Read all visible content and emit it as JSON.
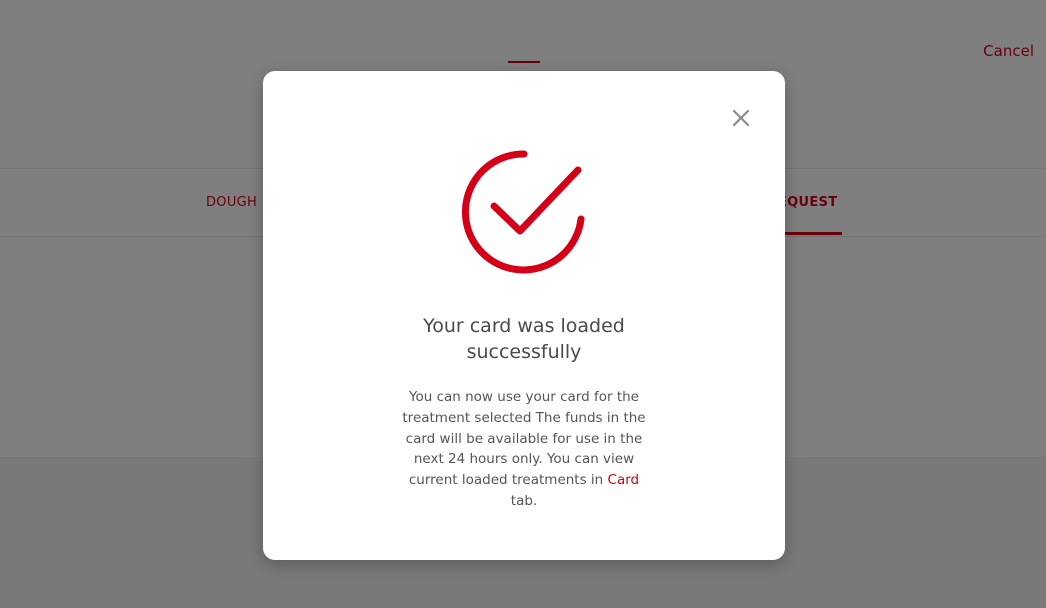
{
  "header": {
    "cancel_label": "Cancel"
  },
  "tabs": {
    "left_label": "DOUGH",
    "right_label": "EQUEST"
  },
  "modal": {
    "title": "Your card was loaded successfully",
    "message_before_link": "You can now use your card for the treatment selected The funds in the card will be available for use in the next 24 hours only. You can view current loaded treatments in ",
    "link_label": "Card",
    "message_after_link": " tab.",
    "icons": {
      "success": "checkmark-circle-icon",
      "close": "close-icon"
    }
  },
  "colors": {
    "accent": "#d50018",
    "text": "#4a4a4a",
    "overlay": "rgba(0,0,0,0.5)"
  }
}
